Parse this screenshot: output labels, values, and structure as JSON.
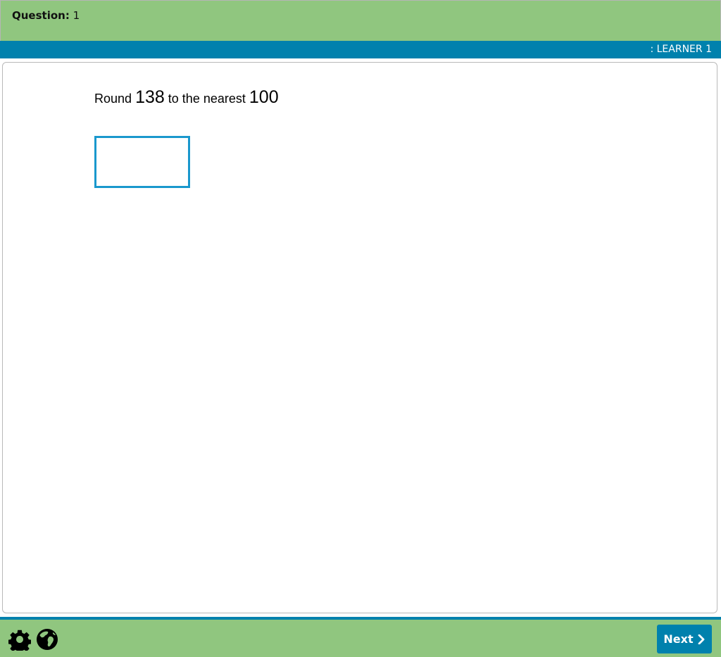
{
  "header": {
    "question_label": "Question:",
    "question_number": "1"
  },
  "learner_bar": {
    "learner_text": ": LEARNER 1"
  },
  "question": {
    "prefix": "Round",
    "number": "138",
    "middle": "to the nearest",
    "target": "100"
  },
  "answer": {
    "value": ""
  },
  "footer": {
    "settings_icon": "gear-icon",
    "language_icon": "globe-icon",
    "next_label": "Next",
    "next_icon": "chevron-right-icon"
  },
  "colors": {
    "header_green": "#90c67f",
    "accent_blue": "#0081ad",
    "input_border_blue": "#1a98cd"
  }
}
